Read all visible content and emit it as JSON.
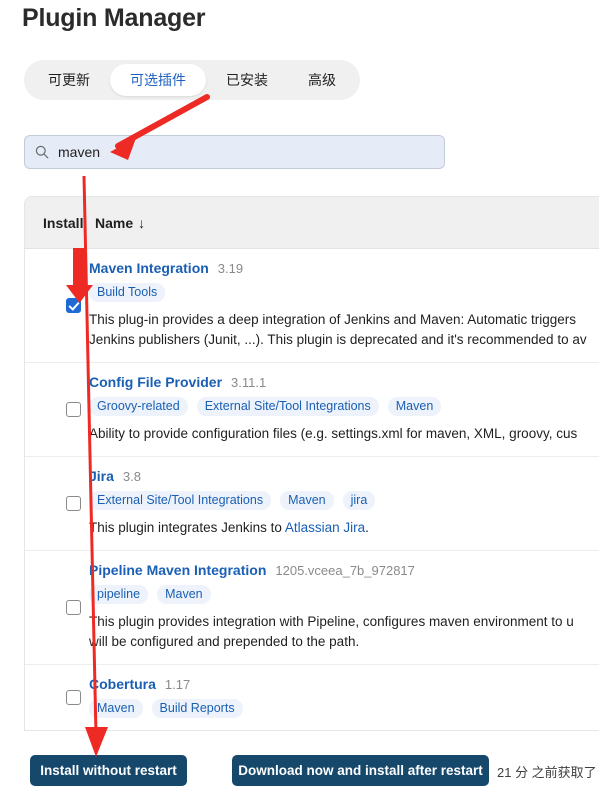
{
  "header": {
    "title": "Plugin Manager"
  },
  "tabs": [
    {
      "label": "可更新",
      "active": false
    },
    {
      "label": "可选插件",
      "active": true
    },
    {
      "label": "已安装",
      "active": false
    },
    {
      "label": "高级",
      "active": false
    }
  ],
  "search": {
    "value": "maven",
    "placeholder": "",
    "icon": "search-icon"
  },
  "table": {
    "columns": {
      "install": "Install",
      "name": "Name",
      "sort_indicator": "↓"
    },
    "rows": [
      {
        "name": "Maven Integration",
        "version": "3.19",
        "checked": true,
        "labels": [
          "Build Tools"
        ],
        "description": "This plug-in provides a deep integration of Jenkins and Maven: Automatic triggers\nJenkins publishers (Junit, ...). This plugin is deprecated and it's recommended to av"
      },
      {
        "name": "Config File Provider",
        "version": "3.11.1",
        "checked": false,
        "labels": [
          "Groovy-related",
          "External Site/Tool Integrations",
          "Maven"
        ],
        "description": "Ability to provide configuration files (e.g. settings.xml for maven, XML, groovy, cus"
      },
      {
        "name": "Jira",
        "version": "3.8",
        "checked": false,
        "labels": [
          "External Site/Tool Integrations",
          "Maven",
          "jira"
        ],
        "description": "This plugin integrates Jenkins to ",
        "description_link": "Atlassian Jira",
        "description_tail": "."
      },
      {
        "name": "Pipeline Maven Integration",
        "version": "1205.vceea_7b_972817",
        "checked": false,
        "labels": [
          "pipeline",
          "Maven"
        ],
        "description": "This plugin provides integration with Pipeline, configures maven environment to u\nwill be configured and prepended to the path."
      },
      {
        "name": "Cobertura",
        "version": "1.17",
        "checked": false,
        "labels": [
          "Maven",
          "Build Reports"
        ],
        "description": ""
      }
    ]
  },
  "footer": {
    "install_without_restart": "Install without restart",
    "download_install_after_restart": "Download now and install after restart",
    "fetch_status": "21 分 之前获取了"
  },
  "colors": {
    "accent_link": "#1a5fb4",
    "checkbox_checked": "#1d6ad4",
    "button_bg": "#16486c",
    "tab_active_text": "#1f62c4",
    "search_bg": "#e6ecf7",
    "annotation_arrow": "#ee2a24"
  }
}
